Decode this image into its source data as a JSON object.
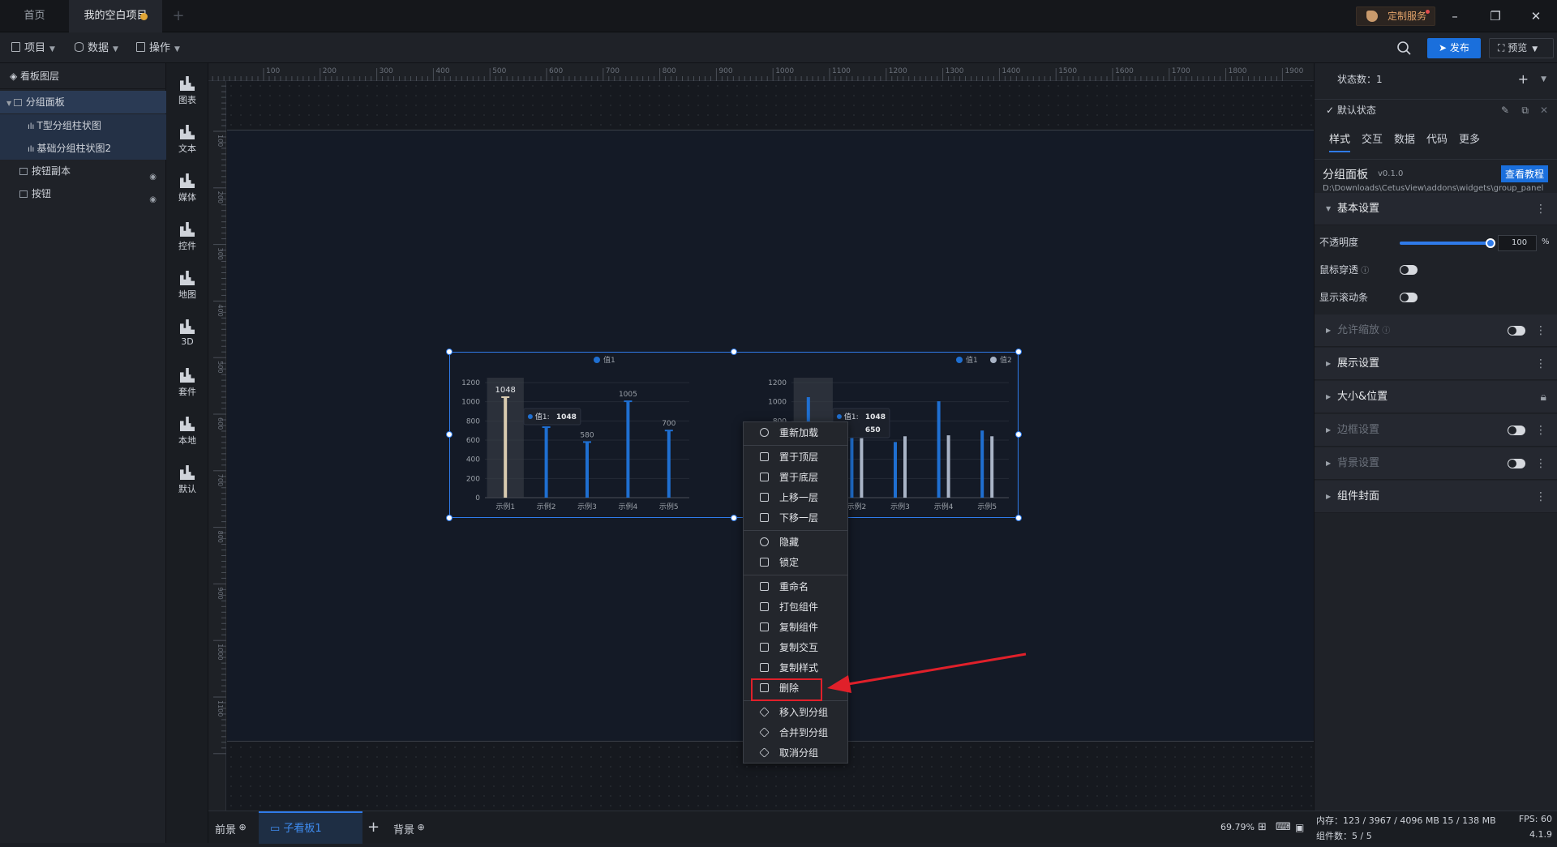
{
  "tabs": {
    "home": "首页",
    "project": "我的空白项目",
    "service": "定制服务"
  },
  "menu": {
    "project": "项目",
    "data": "数据",
    "operate": "操作",
    "publish": "发布",
    "preview": "预览"
  },
  "layers": {
    "title": "看板图层",
    "items": [
      {
        "label": "分组面板"
      },
      {
        "label": "T型分组柱状图"
      },
      {
        "label": "基础分组柱状图2"
      },
      {
        "label": "按钮副本"
      },
      {
        "label": "按钮"
      }
    ]
  },
  "widgets": [
    "图表",
    "文本",
    "媒体",
    "控件",
    "地图",
    "3D",
    "套件",
    "本地",
    "默认"
  ],
  "ruler": {
    "top": [
      "100",
      "200",
      "300",
      "400",
      "500",
      "600",
      "700",
      "800",
      "900",
      "1000",
      "1100",
      "1200",
      "1300",
      "1400",
      "1500",
      "1600",
      "1700",
      "1800",
      "1900"
    ],
    "left": [
      "100",
      "200",
      "300",
      "400",
      "500",
      "600",
      "700",
      "800",
      "900",
      "1000",
      "1100"
    ]
  },
  "chart_data": [
    {
      "type": "bar",
      "categories": [
        "示例1",
        "示例2",
        "示例3",
        "示例4",
        "示例5"
      ],
      "series": [
        {
          "name": "值1",
          "values": [
            1048,
            735,
            580,
            1005,
            700
          ]
        }
      ],
      "data_labels": [
        "1048",
        "580",
        "1005",
        "700"
      ],
      "ylim": [
        0,
        1200
      ],
      "yticks": [
        "1200",
        "1000",
        "800",
        "600",
        "400",
        "200",
        "0"
      ],
      "tooltip": {
        "label": "值1:",
        "value": "1048"
      },
      "legend": "top-center",
      "colors": [
        "#1f6fd1"
      ]
    },
    {
      "type": "bar",
      "categories": [
        "示例1",
        "示例2",
        "示例3",
        "示例4",
        "示例5"
      ],
      "series": [
        {
          "name": "值1",
          "values": [
            1048,
            735,
            580,
            1005,
            700
          ]
        },
        {
          "name": "值2",
          "values": [
            650,
            620,
            640,
            650,
            640
          ]
        }
      ],
      "ylim": [
        0,
        1200
      ],
      "yticks": [
        "1200",
        "1000",
        "800",
        "600",
        "400",
        "200",
        "0"
      ],
      "tooltip": {
        "lines": [
          {
            "label": "值1:",
            "value": "1048"
          },
          {
            "label": "",
            "value": "650"
          }
        ]
      },
      "legend": "top-right",
      "colors": [
        "#1f6fd1",
        "#a9b4c6"
      ]
    }
  ],
  "context_menu": {
    "items": [
      "重新加载",
      "置于顶层",
      "置于底层",
      "上移一层",
      "下移一层",
      "隐藏",
      "锁定",
      "重命名",
      "打包组件",
      "复制组件",
      "复制交互",
      "复制样式",
      "删除",
      "移入到分组",
      "合并到分组",
      "取消分组"
    ]
  },
  "bottom": {
    "front": "前景",
    "sub": "子看板1",
    "back": "背景",
    "zoom": "69.79%"
  },
  "right": {
    "state_count": "状态数：1",
    "default_state": "默认状态",
    "tabs": [
      "样式",
      "交互",
      "数据",
      "代码",
      "更多"
    ],
    "component": {
      "name": "分组面板",
      "version": "v0.1.0",
      "tutorial": "查看教程",
      "path": "D:\\Downloads\\CetusView\\addons\\widgets\\group_panel"
    },
    "basic": "基本设置",
    "opacity_label": "不透明度",
    "opacity_value": "100",
    "opacity_unit": "%",
    "opacity_level": 100,
    "mouse_through": "鼠标穿透",
    "scrollbar": "显示滚动条",
    "sections": [
      "允许缩放",
      "展示设置",
      "大小&位置",
      "边框设置",
      "背景设置",
      "组件封面"
    ]
  },
  "status": {
    "memory": "内存：123 / 3967 / 4096 MB 15 / 138 MB",
    "fps": "FPS: 60",
    "components": "组件数：5 / 5",
    "version": "4.1.9"
  },
  "colors": {
    "accent": "#1a6fdc",
    "bar": "#1f6fd1",
    "bar2": "#a9b4c6",
    "highlight": "#e0202a"
  }
}
